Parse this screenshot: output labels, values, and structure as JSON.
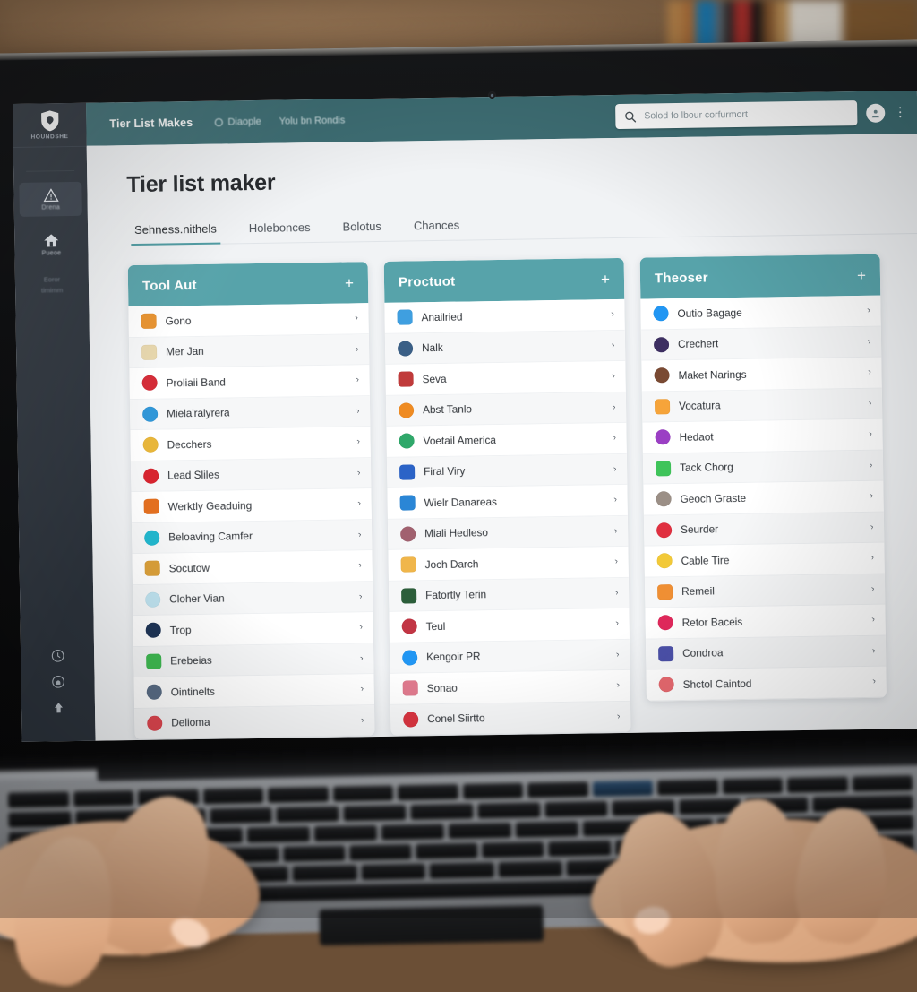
{
  "app": {
    "brand": "Tier List Makes",
    "page_title": "Tier list maker",
    "topnav": [
      {
        "label": "Diaople",
        "icon": "circle-outline-icon"
      },
      {
        "label": "Yolu bn Rondis",
        "icon": "none"
      }
    ],
    "search": {
      "placeholder": "Solod fo lbour corfurmort",
      "value": "",
      "icon": "search-icon"
    },
    "avatar_icon": "user-avatar-icon",
    "overflow_icon": "kebab-menu-icon"
  },
  "sidebar": {
    "logo_label": "HOUNDSHE",
    "logo_icon": "shield-icon",
    "items": [
      {
        "label": "Drena",
        "icon": "warning-triangle-icon",
        "active": true
      },
      {
        "label": "Pueoe",
        "icon": "home-icon",
        "active": false
      }
    ],
    "note_lines": [
      "Eoror",
      "timimm"
    ],
    "bottom_icons": [
      {
        "name": "clock-icon"
      },
      {
        "name": "lock-icon"
      },
      {
        "name": "upload-arrow-icon"
      }
    ]
  },
  "tabs": [
    {
      "label": "Sehness.nithels",
      "active": true
    },
    {
      "label": "Holebonces",
      "active": false
    },
    {
      "label": "Bolotus",
      "active": false
    },
    {
      "label": "Chances",
      "active": false
    }
  ],
  "colors": {
    "topbar": "#3e6e74",
    "column_header": "#57a3aa",
    "tab_underline": "#4e9ba2",
    "page_bg": "#f1f3f5",
    "rail": "#2c333c",
    "row_alt": "#f6f7f8"
  },
  "columns": [
    {
      "title": "Tool Aut",
      "add_label": "+",
      "rows": [
        {
          "label": "Gono",
          "icon": "app-icon-orange",
          "color": "#e8922e",
          "shape": "square",
          "chevron": "›"
        },
        {
          "label": "Mer Jan",
          "icon": "app-icon-cream",
          "color": "#e7d6ac",
          "shape": "square",
          "chevron": "›"
        },
        {
          "label": "Proliaii Band",
          "icon": "app-icon-red",
          "color": "#d42a36",
          "shape": "circle",
          "chevron": "›"
        },
        {
          "label": "Miela'ralyrera",
          "icon": "app-icon-blue",
          "color": "#2f96d8",
          "shape": "circle",
          "chevron": "›"
        },
        {
          "label": "Decchers",
          "icon": "app-icon-chrome",
          "color": "#e8b63a",
          "shape": "circle",
          "chevron": "›"
        },
        {
          "label": "Lead Sliles",
          "icon": "app-icon-crimson",
          "color": "#d8242f",
          "shape": "circle",
          "chevron": "›"
        },
        {
          "label": "Werktly Geaduing",
          "icon": "app-icon-amber",
          "color": "#e5701f",
          "shape": "square",
          "chevron": "›"
        },
        {
          "label": "Beloaving Camfer",
          "icon": "app-icon-cyan",
          "color": "#22b8cf",
          "shape": "circle",
          "chevron": "›"
        },
        {
          "label": "Socutow",
          "icon": "app-icon-gold",
          "color": "#dba03a",
          "shape": "square",
          "chevron": "›"
        },
        {
          "label": "Cloher Vian",
          "icon": "app-icon-lightblue",
          "color": "#bfe3f0",
          "shape": "circle",
          "chevron": "›"
        },
        {
          "label": "Trop",
          "icon": "app-icon-navy",
          "color": "#1f3558",
          "shape": "circle",
          "chevron": "›"
        },
        {
          "label": "Erebeias",
          "icon": "app-icon-green",
          "color": "#3fbb52",
          "shape": "square",
          "chevron": "›"
        },
        {
          "label": "Ointinelts",
          "icon": "app-icon-portrait",
          "color": "#5a6d86",
          "shape": "circle",
          "chevron": "›"
        },
        {
          "label": "Delioma",
          "icon": "app-icon-rose",
          "color": "#e0464f",
          "shape": "circle",
          "chevron": "›"
        }
      ]
    },
    {
      "title": "Proctuot",
      "add_label": "+",
      "rows": [
        {
          "label": "Anailried",
          "icon": "app-icon-skyblue",
          "color": "#3f9fe0",
          "shape": "square",
          "chevron": "›"
        },
        {
          "label": "Nalk",
          "icon": "app-icon-steel",
          "color": "#3a5f86",
          "shape": "circle",
          "chevron": "›"
        },
        {
          "label": "Seva",
          "icon": "app-icon-collage",
          "color": "#c03a3a",
          "shape": "square",
          "chevron": "›"
        },
        {
          "label": "Abst Tanlo",
          "icon": "app-icon-orange2",
          "color": "#ef8b22",
          "shape": "circle",
          "chevron": "›"
        },
        {
          "label": "Voetail America",
          "icon": "app-icon-teal",
          "color": "#2fa86a",
          "shape": "circle",
          "chevron": "›"
        },
        {
          "label": "Firal Viry",
          "icon": "app-icon-royal",
          "color": "#2b63c7",
          "shape": "square",
          "chevron": "›"
        },
        {
          "label": "Wielr Danareas",
          "icon": "app-icon-azure",
          "color": "#2a86d6",
          "shape": "square",
          "chevron": "›"
        },
        {
          "label": "Miali Hedleso",
          "icon": "app-icon-mauve",
          "color": "#a1616f",
          "shape": "circle",
          "chevron": "›"
        },
        {
          "label": "Joch Darch",
          "icon": "app-icon-sand",
          "color": "#f0b64b",
          "shape": "square",
          "chevron": "›"
        },
        {
          "label": "Fatortly Terin",
          "icon": "app-icon-forest",
          "color": "#2c5e3a",
          "shape": "square",
          "chevron": "›"
        },
        {
          "label": "Teul",
          "icon": "app-icon-duo",
          "color": "#c23544",
          "shape": "circle",
          "chevron": "›"
        },
        {
          "label": "Kengoir PR",
          "icon": "app-icon-check",
          "color": "#2196f3",
          "shape": "circle",
          "chevron": "›"
        },
        {
          "label": "Sonao",
          "icon": "app-icon-pink",
          "color": "#e07a8e",
          "shape": "square",
          "chevron": "›"
        },
        {
          "label": "Conel Siirtto",
          "icon": "app-icon-scarlet",
          "color": "#d93440",
          "shape": "circle",
          "chevron": "›"
        }
      ]
    },
    {
      "title": "Theoser",
      "add_label": "+",
      "rows": [
        {
          "label": "Outio Bagage",
          "icon": "app-icon-brightblue",
          "color": "#2196f3",
          "shape": "circle",
          "chevron": "›"
        },
        {
          "label": "Crechert",
          "icon": "app-icon-indigo",
          "color": "#3d2f62",
          "shape": "circle",
          "chevron": "›"
        },
        {
          "label": "Maket Narings",
          "icon": "app-icon-portrait2",
          "color": "#7a4a33",
          "shape": "circle",
          "chevron": "›"
        },
        {
          "label": "Vocatura",
          "icon": "app-icon-peach",
          "color": "#f6a43a",
          "shape": "square",
          "chevron": "›"
        },
        {
          "label": "Hedaot",
          "icon": "app-icon-purple",
          "color": "#9b3fc4",
          "shape": "circle",
          "chevron": "›"
        },
        {
          "label": "Tack Chorg",
          "icon": "app-icon-lime",
          "color": "#3fc45a",
          "shape": "square",
          "chevron": "›"
        },
        {
          "label": "Geoch Graste",
          "icon": "app-icon-grey",
          "color": "#9b8f86",
          "shape": "circle",
          "chevron": "›"
        },
        {
          "label": "Seurder",
          "icon": "app-icon-red2",
          "color": "#e03040",
          "shape": "circle",
          "chevron": "›"
        },
        {
          "label": "Cable Tire",
          "icon": "app-icon-yellowblue",
          "color": "#f2c938",
          "shape": "circle",
          "chevron": "›"
        },
        {
          "label": "Remeil",
          "icon": "app-icon-tangerine",
          "color": "#ef8f33",
          "shape": "square",
          "chevron": "›"
        },
        {
          "label": "Retor Baceis",
          "icon": "app-icon-magenta",
          "color": "#e0275a",
          "shape": "circle",
          "chevron": "›"
        },
        {
          "label": "Condroa",
          "icon": "app-icon-violet",
          "color": "#4a4fa8",
          "shape": "square",
          "chevron": "›"
        },
        {
          "label": "Shctol Caintod",
          "icon": "app-icon-salmon",
          "color": "#e8686e",
          "shape": "circle",
          "chevron": "›"
        }
      ]
    }
  ]
}
